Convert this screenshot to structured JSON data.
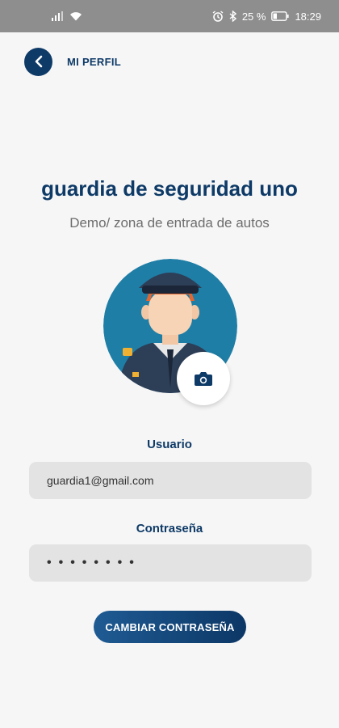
{
  "status_bar": {
    "battery": "25 %",
    "time": "18:29",
    "icons": [
      "signal-icon",
      "wifi-icon",
      "alarm-icon",
      "bluetooth-icon",
      "battery-icon"
    ]
  },
  "header": {
    "back_icon": "chevron-left-icon",
    "title": "MI PERFIL"
  },
  "profile": {
    "name": "guardia de seguridad uno",
    "zone": "Demo/ zona de entrada de autos",
    "avatar": "security-guard-avatar",
    "camera_icon": "camera-icon"
  },
  "form": {
    "user_label": "Usuario",
    "user_value": "guardia1@gmail.com",
    "password_label": "Contraseña",
    "password_value": "••••••••"
  },
  "actions": {
    "change_password_label": "CAMBIAR CONTRASEÑA"
  },
  "colors": {
    "primary": "#0e3a67",
    "avatar_bg": "#1f7ea6",
    "field_bg": "#e3e3e3",
    "background": "#f6f6f6"
  }
}
